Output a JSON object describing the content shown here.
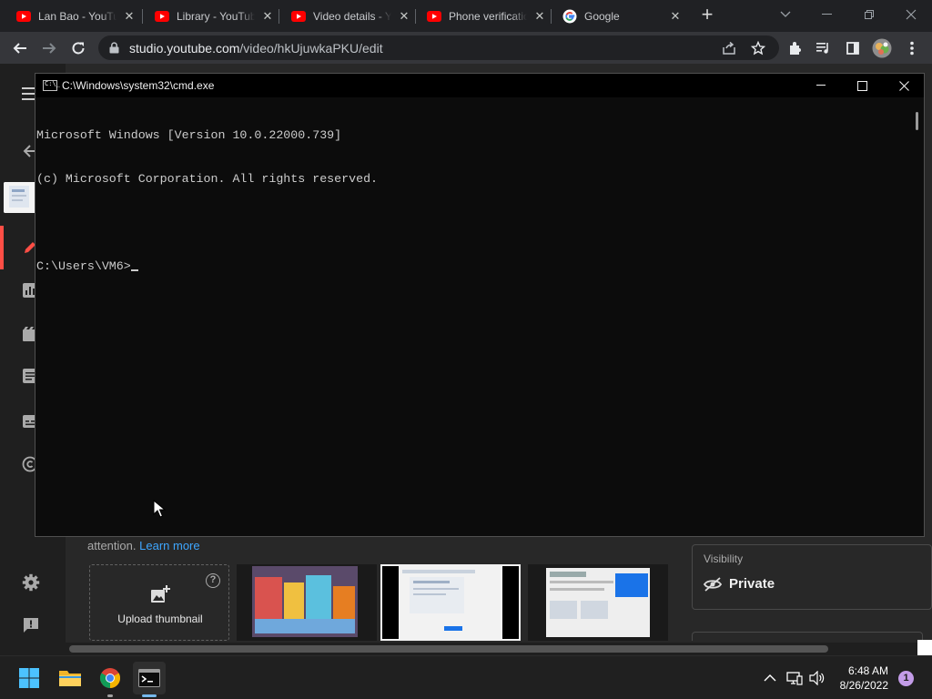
{
  "browser": {
    "tabs": [
      {
        "label": "Lan Bao - YouTube",
        "favicon": "youtube-icon"
      },
      {
        "label": "Library - YouTube",
        "favicon": "youtube-icon"
      },
      {
        "label": "Video details - YouTube Studio",
        "favicon": "youtube-icon"
      },
      {
        "label": "Phone verification",
        "favicon": "youtube-icon"
      },
      {
        "label": "Google",
        "favicon": "google-icon"
      }
    ],
    "url_host": "studio.youtube.com",
    "url_path": "/video/hkUjuwkaPKU/edit"
  },
  "studio": {
    "attention_text": "attention.",
    "learn_more": "Learn more",
    "upload_thumbnail": "Upload thumbnail",
    "help_glyph": "?",
    "visibility_label": "Visibility",
    "visibility_value": "Private"
  },
  "cmd": {
    "title": "C:\\Windows\\system32\\cmd.exe",
    "icon_text": "C:\\_",
    "lines": [
      "Microsoft Windows [Version 10.0.22000.739]",
      "(c) Microsoft Corporation. All rights reserved.",
      "",
      "C:\\Users\\VM6>"
    ]
  },
  "taskbar": {
    "time": "6:48 AM",
    "date": "8/26/2022",
    "notification_count": "1"
  },
  "colors": {
    "accent": "#ff4e45",
    "link": "#3ea6ff",
    "youtube_red": "#ff0000"
  }
}
